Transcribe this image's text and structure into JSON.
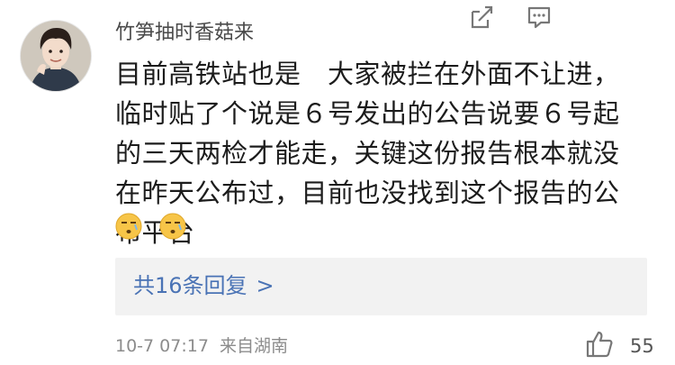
{
  "comment": {
    "username": "竹笋抽时香菇来",
    "text": "目前高铁站也是　大家被拦在外面不让进，临时贴了个说是６号发出的公告说要６号起的三天两检才能走，关键这份报告根本就没在昨天公布过，目前也没找到这个报告的公布平台",
    "emojis": [
      "awkward-face-emoji",
      "awkward-face-emoji"
    ],
    "replies": {
      "label": "共16条回复",
      "chevron": ">"
    },
    "timestamp": "10-7 07:17",
    "location": "来自湖南",
    "actions": {
      "share_icon": "share-icon",
      "comment_icon": "comment-icon",
      "like_icon": "thumbs-up-icon",
      "like_count": "55"
    }
  },
  "colors": {
    "link": "#4a73b5",
    "reply_bg": "#f2f2f2",
    "meta": "#8c8c8c"
  }
}
